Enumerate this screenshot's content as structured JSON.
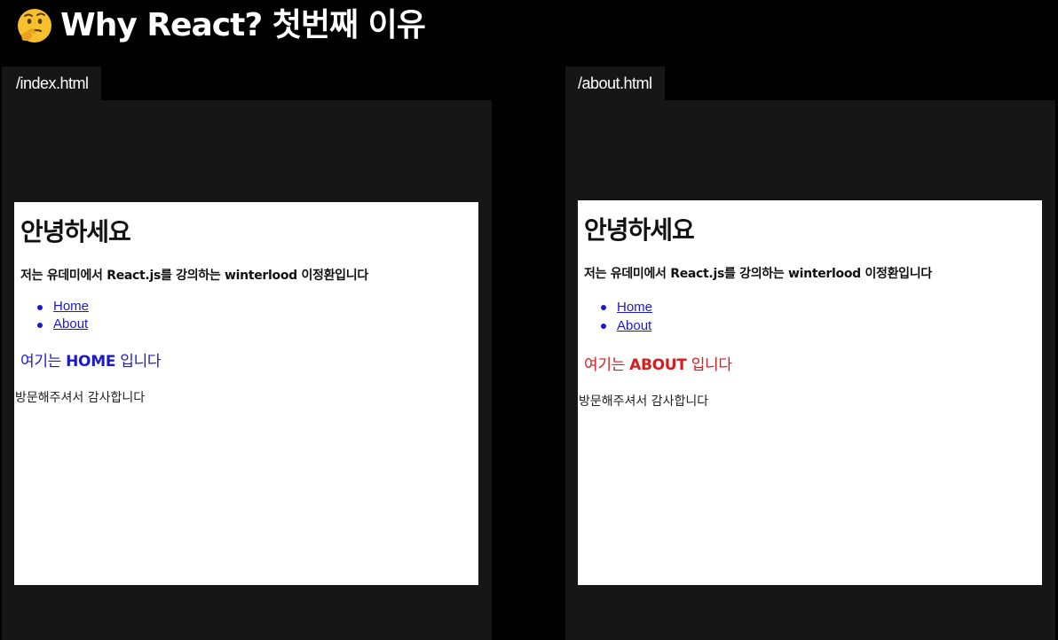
{
  "header": {
    "title": "Why React? 첫번째 이유",
    "emoji_icon": "thinking-face-icon"
  },
  "panels": [
    {
      "tab": "/index.html",
      "page": {
        "heading": "안녕하세요",
        "intro": "저는 유데미에서 React.js를 강의하는 winterlood 이정환입니다",
        "nav": [
          "Home",
          "About"
        ],
        "status_prefix": "여기는 ",
        "status_strong": "HOME",
        "status_suffix": " 입니다",
        "status_color": "#1a1acc",
        "thanks": "방문해주셔서 감사합니다"
      }
    },
    {
      "tab": "/about.html",
      "page": {
        "heading": "안녕하세요",
        "intro": "저는 유데미에서 React.js를 강의하는 winterlood 이정환입니다",
        "nav": [
          "Home",
          "About"
        ],
        "status_prefix": "여기는 ",
        "status_strong": "ABOUT",
        "status_suffix": " 입니다",
        "status_color": "#d41e1e",
        "thanks": "방문해주셔서 감사합니다"
      }
    }
  ]
}
